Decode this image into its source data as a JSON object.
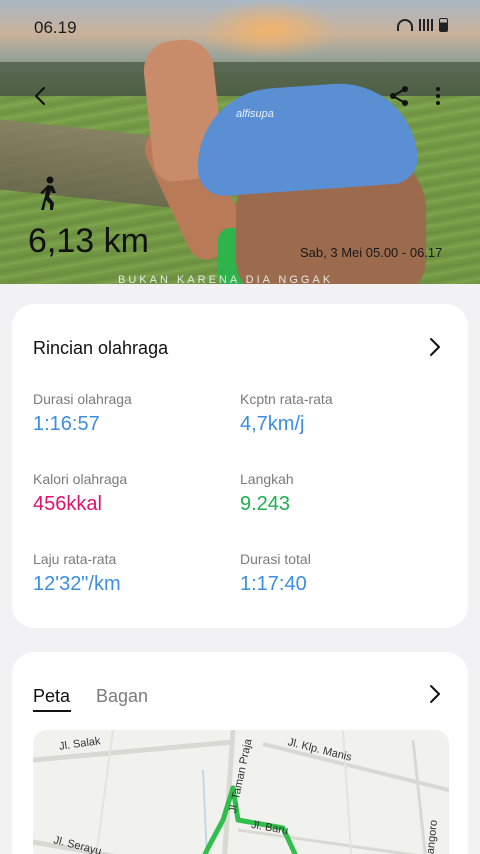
{
  "status_bar": {
    "time": "06.19",
    "icons": [
      "wifi-icon",
      "signal-icon",
      "battery-icon"
    ]
  },
  "header": {
    "icons": [
      "back-icon",
      "share-icon",
      "more-icon",
      "walk-icon"
    ],
    "distance": "6,13 km",
    "date": "Sab, 3 Mei 05.00 - 06.17",
    "caption": "BUKAN KARENA DIA NGGAK",
    "cap_logo": "alfisupa"
  },
  "details": {
    "title": "Rincian olahraga",
    "metrics": [
      {
        "label": "Durasi olahraga",
        "value": "1:16:57",
        "color": "#3b8ee0"
      },
      {
        "label": "Kcptn rata-rata",
        "value": "4,7km/j",
        "color": "#3b8ee0"
      },
      {
        "label": "Kalori olahraga",
        "value": "456kkal",
        "color": "#e0116e"
      },
      {
        "label": "Langkah",
        "value": "9.243",
        "color": "#1fae4e"
      },
      {
        "label": "Laju rata-rata",
        "value": "12'32\"/km",
        "color": "#3b8ee0"
      },
      {
        "label": "Durasi total",
        "value": "1:17:40",
        "color": "#3b8ee0"
      }
    ]
  },
  "map_card": {
    "tabs": [
      {
        "label": "Peta",
        "active": true
      },
      {
        "label": "Bagan",
        "active": false
      }
    ],
    "streets": [
      "Jl. Salak",
      "Jl. Taman Praja",
      "Jl. Klp. Manis",
      "Jl. Baru",
      "Jl. Serayu",
      "Jl. Nangoro"
    ],
    "route_color": "#2fbf4a"
  }
}
